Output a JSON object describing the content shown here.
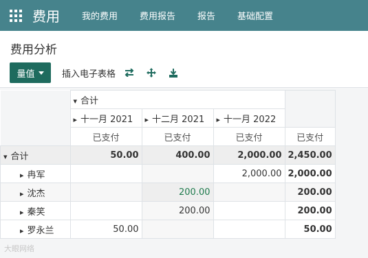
{
  "nav": {
    "brand": "费用",
    "menu": [
      "我的费用",
      "费用报告",
      "报告",
      "基础配置"
    ]
  },
  "page": {
    "title": "费用分析",
    "measure_label": "量值",
    "insert_label": "插入电子表格"
  },
  "pivot": {
    "row_total_label": "合计",
    "col_total_label": "合计",
    "col_groups": [
      "十一月 2021",
      "十二月 2021",
      "十一月 2022"
    ],
    "measure_header": "已支付",
    "total_row_values": [
      "50.00",
      "400.00",
      "2,000.00",
      "2,450.00"
    ],
    "rows": [
      {
        "name": "冉军",
        "values": [
          "",
          "",
          "2,000.00",
          "2,000.00"
        ]
      },
      {
        "name": "沈杰",
        "values": [
          "",
          "200.00",
          "",
          "200.00"
        ]
      },
      {
        "name": "秦笑",
        "values": [
          "",
          "200.00",
          "",
          "200.00"
        ]
      },
      {
        "name": "罗永兰",
        "values": [
          "50.00",
          "",
          "",
          "50.00"
        ]
      }
    ]
  },
  "watermark": "大眼网络"
}
